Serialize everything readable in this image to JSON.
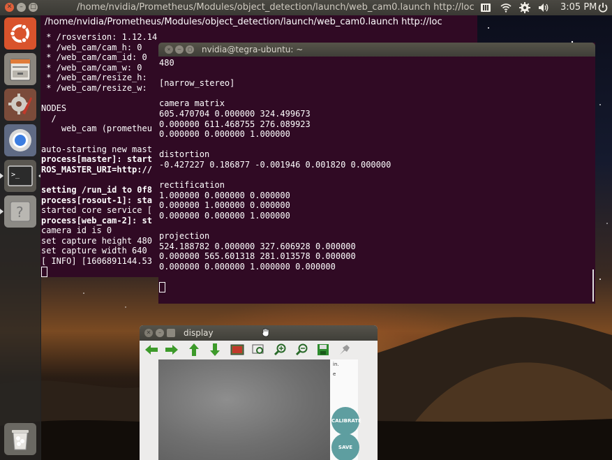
{
  "top_panel": {
    "window_title": "/home/nvidia/Prometheus/Modules/object_detection/launch/web_cam0.launch http://loc",
    "clock": "3:05 PM",
    "icons": [
      "keyboard-indicator-icon",
      "wifi-icon",
      "settings-gear-icon",
      "volume-icon",
      "power-icon"
    ]
  },
  "launcher": {
    "items": [
      "ubuntu-dash-icon",
      "files-icon",
      "system-settings-icon",
      "chromium-icon",
      "terminal-icon",
      "unknown-app-icon",
      "trash-icon"
    ]
  },
  "terminal_back": {
    "lines": [
      {
        "text": " * /rosversion: 1.12.14",
        "bold": false
      },
      {
        "text": " * /web_cam/cam_h: 0",
        "bold": false
      },
      {
        "text": " * /web_cam/cam_id: 0",
        "bold": false
      },
      {
        "text": " * /web_cam/cam_w: 0",
        "bold": false
      },
      {
        "text": " * /web_cam/resize_h:",
        "bold": false
      },
      {
        "text": " * /web_cam/resize_w:",
        "bold": false
      },
      {
        "text": "",
        "bold": false
      },
      {
        "text": "NODES",
        "bold": false
      },
      {
        "text": "  /",
        "bold": false
      },
      {
        "text": "    web_cam (prometheu",
        "bold": false
      },
      {
        "text": "",
        "bold": false
      },
      {
        "text": "auto-starting new mast",
        "bold": false
      },
      {
        "text": "process[master]: start",
        "bold": true
      },
      {
        "text": "ROS_MASTER_URI=http://",
        "bold": true
      },
      {
        "text": "",
        "bold": false
      },
      {
        "text": "setting /run_id to 0f8",
        "bold": true
      },
      {
        "text": "process[rosout-1]: sta",
        "bold": true
      },
      {
        "text": "started core service [",
        "bold": false
      },
      {
        "text": "process[web_cam-2]: st",
        "bold": true
      },
      {
        "text": "camera id is 0",
        "bold": false
      },
      {
        "text": "set capture height 480",
        "bold": false
      },
      {
        "text": "set capture width 640",
        "bold": false
      },
      {
        "text": "[ INFO] [1606891144.53",
        "bold": false
      }
    ]
  },
  "terminal_front": {
    "title": "nvidia@tegra-ubuntu: ~",
    "lines": [
      "480",
      "",
      "[narrow_stereo]",
      "",
      "camera matrix",
      "605.470704 0.000000 324.499673",
      "0.000000 611.468755 276.089923",
      "0.000000 0.000000 1.000000",
      "",
      "distortion",
      "-0.427227 0.186877 -0.001946 0.001820 0.000000",
      "",
      "rectification",
      "1.000000 0.000000 0.000000",
      "0.000000 1.000000 0.000000",
      "0.000000 0.000000 1.000000",
      "",
      "projection",
      "524.188782 0.000000 327.606928 0.000000",
      "0.000000 565.601318 281.013578 0.000000",
      "0.000000 0.000000 1.000000 0.000000"
    ]
  },
  "display_window": {
    "title": "display",
    "toolbar": [
      "back-arrow-icon",
      "forward-arrow-icon",
      "up-arrow-icon",
      "down-arrow-icon",
      "image-icon",
      "zoom-region-icon",
      "zoom-in-icon",
      "zoom-out-icon",
      "save-icon",
      "pin-icon"
    ],
    "side_text": [
      "in.",
      "e"
    ],
    "calibrate_label": "CALIBRATE",
    "save_label": "SAVE"
  }
}
